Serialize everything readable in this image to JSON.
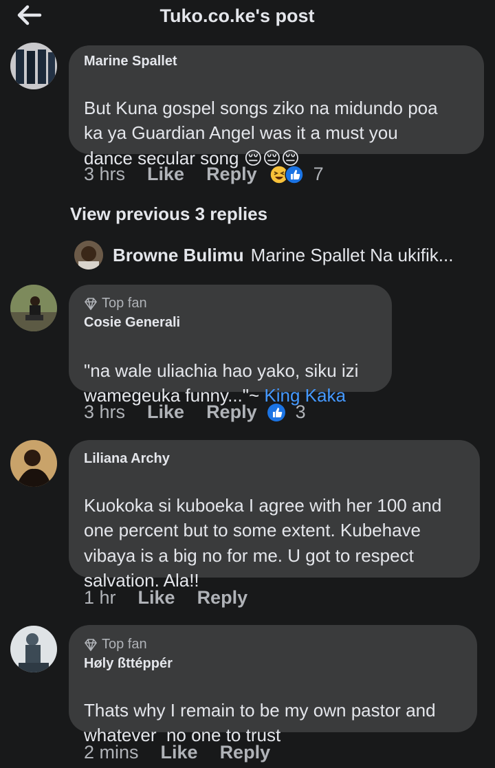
{
  "header": {
    "title": "Tuko.co.ke's post"
  },
  "comments": [
    {
      "author": "Marine Spallet",
      "text": "But Kuna gospel songs ziko na midundo poa ka ya Guardian Angel was it a must you dance secular song 😔😔😔",
      "line1": "But Kuna gospel songs ziko na midundo poa",
      "line2": "ka ya Guardian Angel was it a must you",
      "line3": "dance secular song",
      "emoji": "😔😔😔",
      "time": "3 hrs",
      "like": "Like",
      "reply": "Reply",
      "reaction_count": "7"
    },
    {
      "badge": "Top fan",
      "author": "Cosie Generali",
      "line1": "\"na wale uliachia hao yako, siku izi",
      "line2": "wamegeuka funny...\"~ ",
      "mention": "King Kaka",
      "time": "3 hrs",
      "like": "Like",
      "reply": "Reply",
      "reaction_count": "3"
    },
    {
      "author": "Liliana Archy",
      "line1": "Kuokoka si kuboeka I agree with her 100 and",
      "line2": "one percent but to some extent. Kubehave",
      "line3": "vibaya is a big no for me. U got to respect",
      "line4": "salvation. Ala!!",
      "time": "1 hr",
      "like": "Like",
      "reply": "Reply"
    },
    {
      "badge": "Top fan",
      "author": "Høly ßttéppér",
      "line1": "Thats why I remain to be my own pastor and",
      "line2": "whatever  no one to trust",
      "time": "2 mins",
      "like": "Like",
      "reply": "Reply"
    }
  ],
  "view_previous": "View previous 3 replies",
  "reply_preview": {
    "author": "Browne Bulimu",
    "text": "Marine Spallet Na ukifik..."
  },
  "colors": {
    "background": "#18191a",
    "bubble": "#3a3b3c",
    "link": "#4599ff",
    "secondary_text": "#b0b3b8"
  }
}
